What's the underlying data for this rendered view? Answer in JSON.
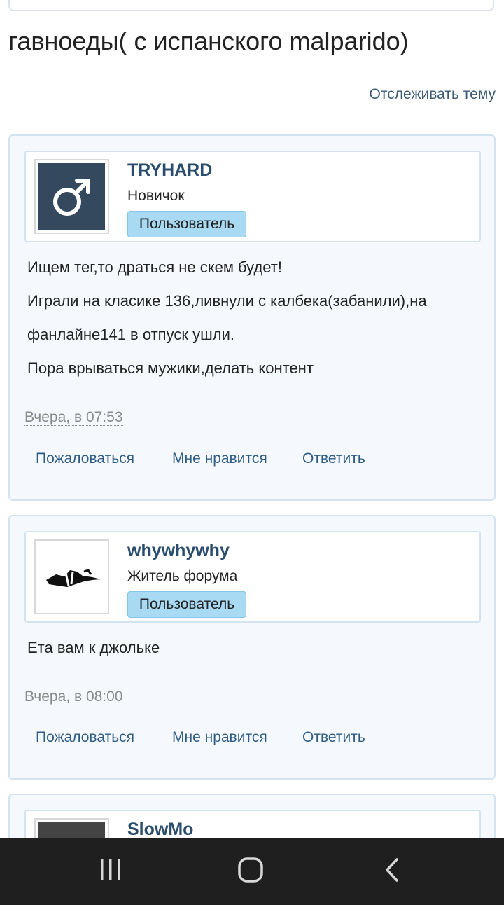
{
  "topic": {
    "title": "гавноеды( с испанского malparido)",
    "follow_label": "Отслеживать тему"
  },
  "posts": [
    {
      "username": "TRYHARD",
      "rank": "Новичок",
      "group": "Пользователь",
      "avatar": "male-symbol-icon",
      "body": [
        "Ищем тег,то драться не скем будет!",
        "Играли на класике 136,ливнули с калбека(забанили),на фанлайне141 в отпуск ушли.",
        "Пора врываться мужики,делать контент"
      ],
      "date": "Вчера, в 07:53",
      "actions": [
        "Пожаловаться",
        "Мне нравится",
        "Ответить"
      ]
    },
    {
      "username": "whywhywhy",
      "rank": "Житель форума",
      "group": "Пользователь",
      "avatar": "sketch-image",
      "body": [
        "Ета вам к джольке"
      ],
      "date": "Вчера, в 08:00",
      "actions": [
        "Пожаловаться",
        "Мне нравится",
        "Ответить"
      ]
    },
    {
      "username": "SlowMo"
    }
  ],
  "system_nav": {
    "recent": "recent-apps-icon",
    "home": "home-icon",
    "back": "back-icon"
  },
  "colors": {
    "accent": "#2a4d6e",
    "link": "#2f5c85",
    "badge": "#a8daf3",
    "post_bg": "#f5f9fd",
    "border": "#d3e3ef",
    "navbar": "#1f1f1f"
  }
}
